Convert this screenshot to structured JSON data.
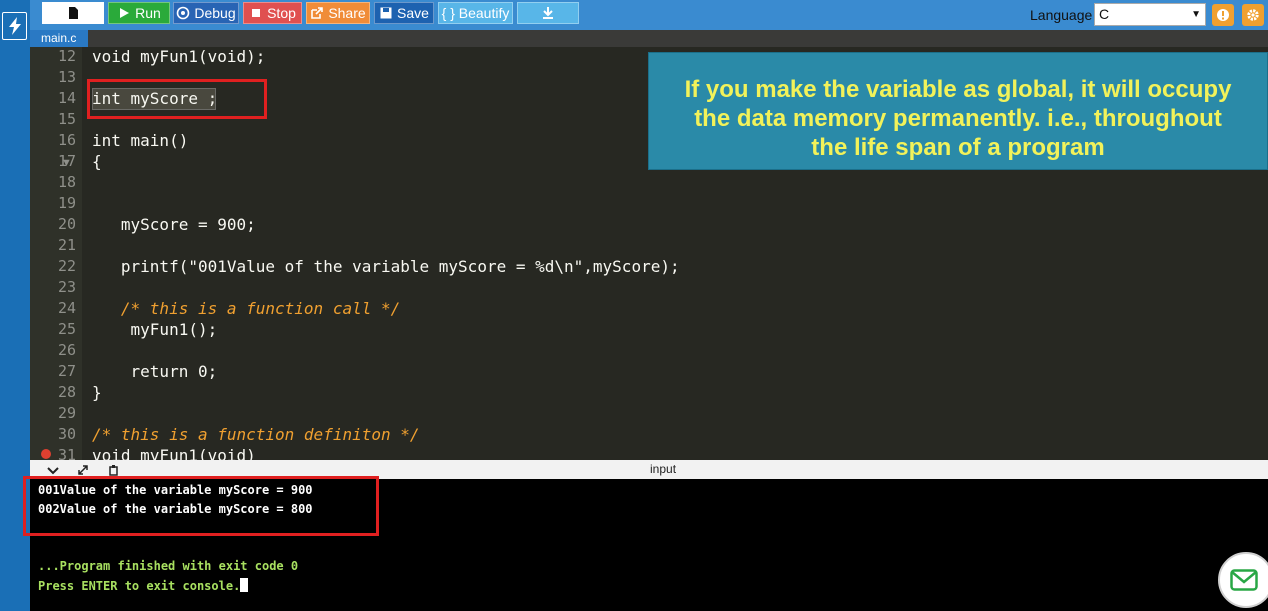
{
  "toolbar": {
    "run_label": "Run",
    "debug_label": "Debug",
    "stop_label": "Stop",
    "share_label": "Share",
    "save_label": "Save",
    "beautify_label": "{ } Beautify",
    "language_label": "Language",
    "language_value": "C"
  },
  "tabs": {
    "main_label": "main.c"
  },
  "editor": {
    "lines": [
      {
        "n": "12",
        "code": "void myFun1(void);"
      },
      {
        "n": "13",
        "code": ""
      },
      {
        "n": "14",
        "code": "int myScore ;"
      },
      {
        "n": "15",
        "code": ""
      },
      {
        "n": "16",
        "code": "int main()"
      },
      {
        "n": "17",
        "code": "{"
      },
      {
        "n": "18",
        "code": ""
      },
      {
        "n": "19",
        "code": ""
      },
      {
        "n": "20",
        "code": "   myScore = 900;"
      },
      {
        "n": "21",
        "code": ""
      },
      {
        "n": "22",
        "code": "   printf(\"001Value of the variable myScore = %d\\n\",myScore);"
      },
      {
        "n": "23",
        "code": ""
      },
      {
        "n": "24",
        "code": "   /* this is a function call */"
      },
      {
        "n": "25",
        "code": "    myFun1();"
      },
      {
        "n": "26",
        "code": ""
      },
      {
        "n": "27",
        "code": "    return 0;"
      },
      {
        "n": "28",
        "code": "}"
      },
      {
        "n": "29",
        "code": ""
      },
      {
        "n": "30",
        "code": "/* this is a function definiton */"
      },
      {
        "n": "31",
        "code": "void myFun1(void)"
      }
    ]
  },
  "callout": {
    "line1": "If you make the variable as global, it will occupy",
    "line2": "the data memory permanently. i.e., throughout",
    "line3": "the life span of a program"
  },
  "console": {
    "title": "input",
    "out1": "001Value of the variable myScore = 900",
    "out2": "002Value of the variable myScore = 800",
    "finish": "...Program finished with exit code 0",
    "press": "Press ENTER to exit console."
  },
  "colors": {
    "toolbar_bg": "#3a8bd0",
    "editor_bg": "#272822",
    "callout_bg": "#2a8aa8",
    "callout_text": "#f2f25a",
    "highlight_red": "#e02020"
  }
}
